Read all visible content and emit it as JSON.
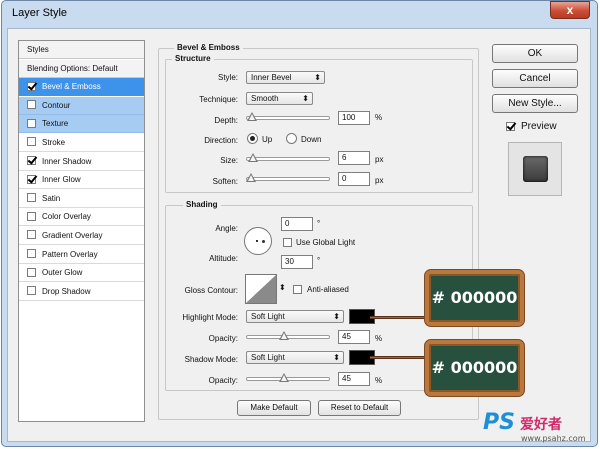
{
  "window": {
    "title": "Layer Style",
    "close_label": "x"
  },
  "sidebar": {
    "items": [
      {
        "label": "Styles",
        "kind": "hdr",
        "checked": null
      },
      {
        "label": "Blending Options: Default",
        "kind": "hdr",
        "checked": null
      },
      {
        "label": "Bevel & Emboss",
        "kind": "sel",
        "checked": true
      },
      {
        "label": "Contour",
        "kind": "sub",
        "checked": false
      },
      {
        "label": "Texture",
        "kind": "sub",
        "checked": false
      },
      {
        "label": "Stroke",
        "kind": "item",
        "checked": false
      },
      {
        "label": "Inner Shadow",
        "kind": "item",
        "checked": true
      },
      {
        "label": "Inner Glow",
        "kind": "item",
        "checked": true
      },
      {
        "label": "Satin",
        "kind": "item",
        "checked": false
      },
      {
        "label": "Color Overlay",
        "kind": "item",
        "checked": false
      },
      {
        "label": "Gradient Overlay",
        "kind": "item",
        "checked": false
      },
      {
        "label": "Pattern Overlay",
        "kind": "item",
        "checked": false
      },
      {
        "label": "Outer Glow",
        "kind": "item",
        "checked": false
      },
      {
        "label": "Drop Shadow",
        "kind": "item",
        "checked": false
      }
    ]
  },
  "panel": {
    "title": "Bevel & Emboss"
  },
  "structure": {
    "title": "Structure",
    "style_label": "Style:",
    "style_value": "Inner Bevel",
    "technique_label": "Technique:",
    "technique_value": "Smooth",
    "depth_label": "Depth:",
    "depth_value": "100",
    "depth_unit": "%",
    "depth_level": 0.01,
    "direction_label": "Direction:",
    "up_label": "Up",
    "down_label": "Down",
    "size_label": "Size:",
    "size_value": "6",
    "size_unit": "px",
    "size_level": 0.03,
    "soften_label": "Soften:",
    "soften_value": "0",
    "soften_unit": "px",
    "soften_level": 0
  },
  "shading": {
    "title": "Shading",
    "angle_label": "Angle:",
    "angle_value": "0",
    "angle_unit": "°",
    "global_light_label": "Use Global Light",
    "altitude_label": "Altitude:",
    "altitude_value": "30",
    "altitude_unit": "°",
    "gloss_label": "Gloss Contour:",
    "anti_aliased_label": "Anti-aliased",
    "highlight_mode_label": "Highlight Mode:",
    "highlight_mode_value": "Soft Light",
    "highlight_color": "#000000",
    "highlight_opacity_label": "Opacity:",
    "highlight_opacity_value": "45",
    "highlight_opacity_unit": "%",
    "highlight_opacity_level": 0.45,
    "shadow_mode_label": "Shadow Mode:",
    "shadow_mode_value": "Soft Light",
    "shadow_color": "#000000",
    "shadow_opacity_label": "Opacity:",
    "shadow_opacity_value": "45",
    "shadow_opacity_unit": "%",
    "shadow_opacity_level": 0.45
  },
  "footer": {
    "make_default": "Make Default",
    "reset_default": "Reset to Default"
  },
  "buttons": {
    "ok": "OK",
    "cancel": "Cancel",
    "new_style": "New Style...",
    "preview": "Preview"
  },
  "callouts": [
    {
      "text": "# 000000"
    },
    {
      "text": "# 000000"
    }
  ],
  "watermark": {
    "brand": "PS",
    "cn": "爱好者",
    "url": "www.psahz.com"
  }
}
